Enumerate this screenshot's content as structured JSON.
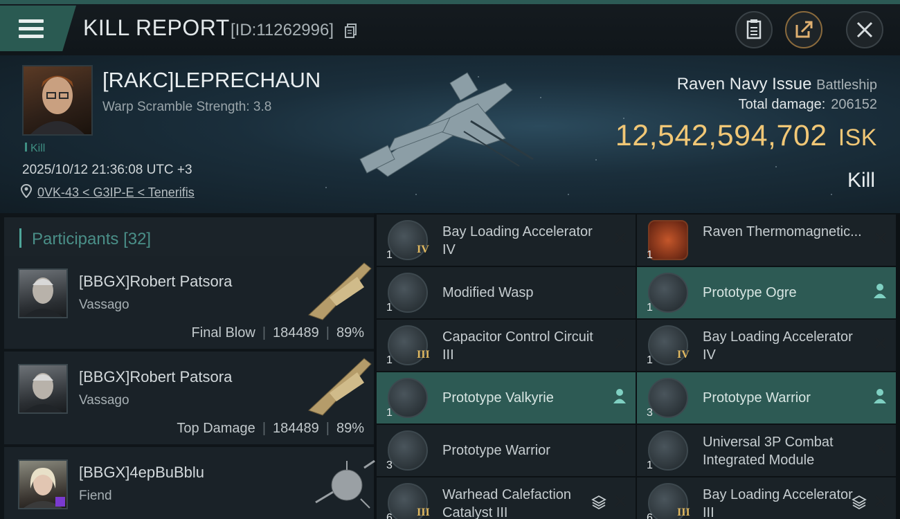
{
  "header": {
    "title": "KILL REPORT",
    "report_id": "[ID:11262996]"
  },
  "victim": {
    "name": "[RAKC]LEPRECHAUN",
    "warp_scramble": "Warp Scramble Strength: 3.8",
    "tag": "Kill",
    "datetime": "2025/10/12 21:36:08 UTC +3",
    "location": "0VK-43 < G3IP-E < Tenerifis",
    "ship_name": "Raven Navy Issue",
    "ship_class": "Battleship",
    "total_damage_label": "Total damage:",
    "total_damage": "206152",
    "isk_value": "12,542,594,702",
    "isk_unit": "ISK",
    "result": "Kill"
  },
  "participants": {
    "label": "Participants",
    "count": "[32]",
    "rows": [
      {
        "name": "[BBGX]Robert Patsora",
        "ship": "Vassago",
        "role": "Final Blow",
        "damage": "184489",
        "percent": "89%"
      },
      {
        "name": "[BBGX]Robert Patsora",
        "ship": "Vassago",
        "role": "Top Damage",
        "damage": "184489",
        "percent": "89%"
      },
      {
        "name": "[BBGX]4epBuBblu",
        "ship": "Fiend",
        "role": "",
        "damage": "",
        "percent": ""
      }
    ]
  },
  "modules": [
    {
      "label": "Bay Loading Accelerator IV",
      "qty": "1",
      "rank": "IV",
      "highlight": false,
      "status": "destroyed",
      "icon": "launcher-module-icon"
    },
    {
      "label": "Raven Thermomagnetic...",
      "qty": "1",
      "rank": "",
      "highlight": false,
      "status": "destroyed",
      "icon": "blueprint-icon"
    },
    {
      "label": "Modified Wasp",
      "qty": "1",
      "rank": "",
      "highlight": false,
      "status": "destroyed",
      "icon": "drone-icon"
    },
    {
      "label": "Prototype Ogre",
      "qty": "1",
      "rank": "",
      "highlight": true,
      "status": "dropped",
      "icon": "drone-icon"
    },
    {
      "label": "Capacitor Control Circuit III",
      "qty": "1",
      "rank": "III",
      "highlight": false,
      "status": "destroyed",
      "icon": "rig-icon"
    },
    {
      "label": "Bay Loading Accelerator IV",
      "qty": "1",
      "rank": "IV",
      "highlight": false,
      "status": "destroyed",
      "icon": "launcher-module-icon"
    },
    {
      "label": "Prototype Valkyrie",
      "qty": "1",
      "rank": "",
      "highlight": true,
      "status": "dropped",
      "icon": "fighter-icon"
    },
    {
      "label": "Prototype Warrior",
      "qty": "3",
      "rank": "",
      "highlight": true,
      "status": "dropped",
      "icon": "fighter-icon"
    },
    {
      "label": "Prototype Warrior",
      "qty": "3",
      "rank": "",
      "highlight": false,
      "status": "destroyed",
      "icon": "fighter-icon"
    },
    {
      "label": "Universal 3P Combat Integrated Module",
      "qty": "1",
      "rank": "",
      "highlight": false,
      "status": "destroyed",
      "icon": "combat-module-icon"
    },
    {
      "label": "Warhead Calefaction Catalyst III",
      "qty": "6",
      "rank": "III",
      "highlight": false,
      "status": "destroyed",
      "stacked": true,
      "icon": "launcher-module-icon"
    },
    {
      "label": "Bay Loading Accelerator III",
      "qty": "6",
      "rank": "III",
      "highlight": false,
      "status": "destroyed",
      "stacked": true,
      "icon": "launcher-module-icon"
    }
  ],
  "colors": {
    "accent": "#2d5a54",
    "isk": "#f1c776",
    "teal_text": "#4a8f88"
  }
}
